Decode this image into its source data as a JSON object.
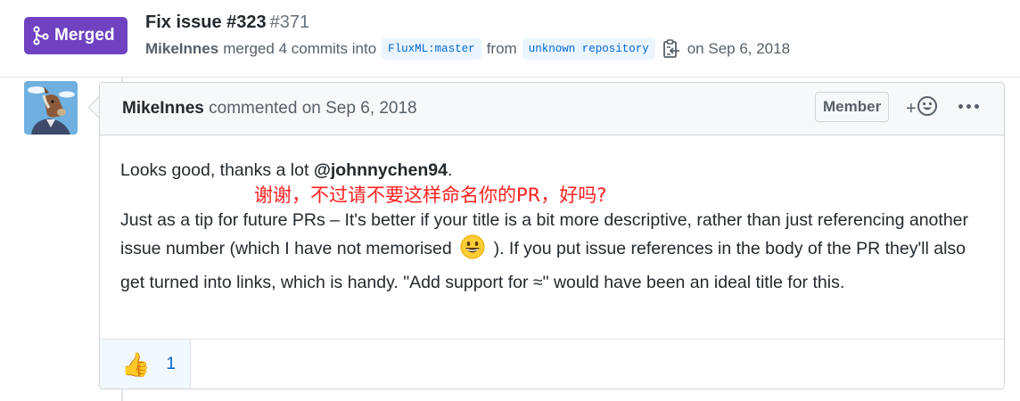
{
  "pr": {
    "state": "Merged",
    "title": "Fix issue #323",
    "number": "#371",
    "author": "MikeInnes",
    "merge_text": "merged 4 commits into",
    "base_branch": "FluxML:master",
    "from_text": "from",
    "head_branch": "unknown repository",
    "date_text": "on Sep 6, 2018"
  },
  "comment": {
    "author": "MikeInnes",
    "action": "commented on Sep 6, 2018",
    "role_badge": "Member",
    "reaction_add": "+",
    "body_line1_text": "Looks good, thanks a lot",
    "body_line1_mention": "@johnnychen94",
    "body_line1_end": ".",
    "annotation": "谢谢，不过请不要这样命名你的PR，好吗?",
    "body_para2_start": "Just as a tip for future PRs – It's better if your title is a bit more descriptive, rather than just referencing another issue number (which I have not memorised",
    "body_para2_end": "). If you put issue references in the body of the PR they'll also get turned into links, which is handy. \"Add support for ≈\" would have been an ideal title for this.",
    "reactions": [
      {
        "emoji": "👍",
        "count": "1"
      }
    ]
  },
  "icons": {
    "merge": "git-merge-icon",
    "copy": "clipboard-copy-icon",
    "smiley": "smiley-icon",
    "kebab": "kebab-horizontal-icon",
    "grin": "grinning-face-icon"
  },
  "colors": {
    "merged_purple": "#6f42c1",
    "link_blue": "#0366d6",
    "annotation_red": "#ff2020"
  }
}
